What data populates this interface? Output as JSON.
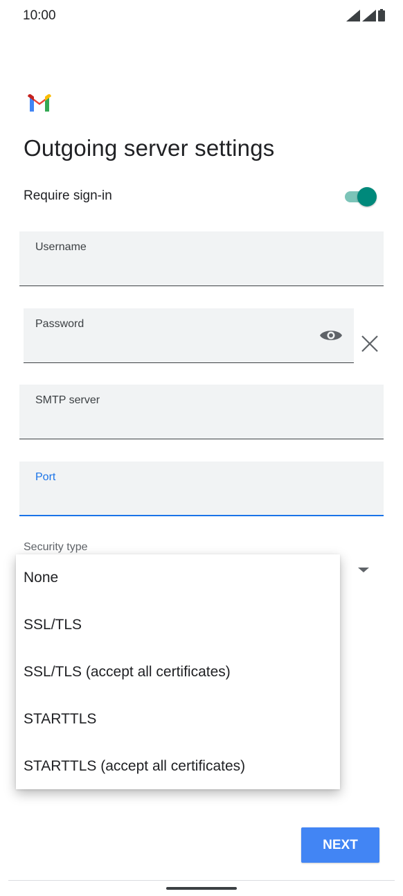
{
  "status_bar": {
    "time": "10:00"
  },
  "page": {
    "title": "Outgoing server settings"
  },
  "signin": {
    "label": "Require sign-in",
    "enabled": true
  },
  "fields": {
    "username": {
      "label": "Username",
      "value": ""
    },
    "password": {
      "label": "Password",
      "value": ""
    },
    "smtp_server": {
      "label": "SMTP server",
      "value": ""
    },
    "port": {
      "label": "Port",
      "value": ""
    }
  },
  "security": {
    "label": "Security type",
    "options": [
      "None",
      "SSL/TLS",
      "SSL/TLS (accept all certificates)",
      "STARTTLS",
      "STARTTLS (accept all certificates)"
    ]
  },
  "actions": {
    "next_label": "NEXT"
  },
  "colors": {
    "accent": "#00897b",
    "focus": "#1a73e8",
    "primary_button": "#4285f4"
  }
}
